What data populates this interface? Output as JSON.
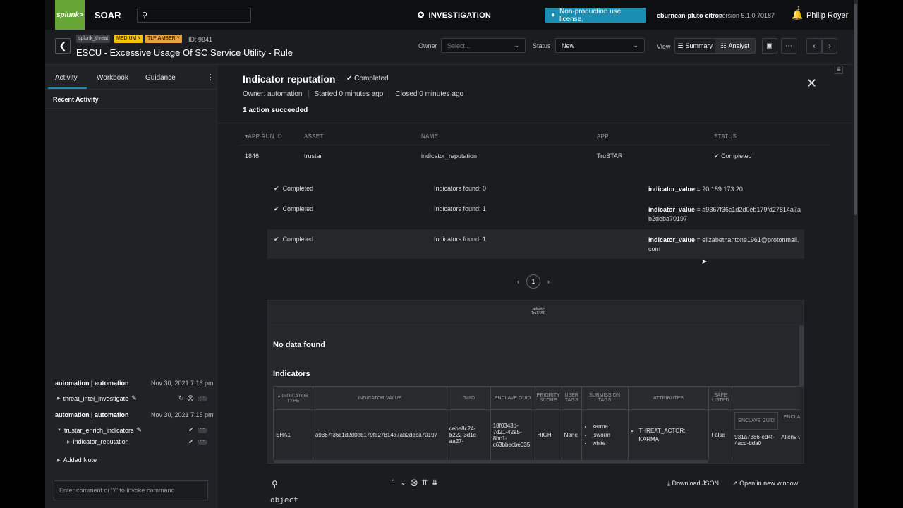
{
  "app": {
    "logo": "splunk>",
    "name": "SOAR",
    "section": "INVESTIGATION",
    "license": "Non-production use license.",
    "instance": "eburnean-pluto-citron",
    "version": "version 5.1.0.70187",
    "bell_count": "1",
    "user": "Philip Royer"
  },
  "event": {
    "tags": [
      "splunk_threat",
      "MEDIUM",
      "TLP:AMBER"
    ],
    "id_label": "ID: 9941",
    "title": "ESCU - Excessive Usage Of SC Service Utility - Rule",
    "owner_label": "Owner",
    "owner_placeholder": "Select...",
    "status_label": "Status",
    "status_value": "New",
    "view_label": "View",
    "view_summary": "Summary",
    "view_analyst": "Analyst"
  },
  "left": {
    "tabs": [
      "Activity",
      "Workbook",
      "Guidance"
    ],
    "recent_label": "Recent Activity",
    "activities": [
      {
        "user": "automation | automation",
        "date": "Nov 30, 2021 7:16 pm",
        "item": "threat_intel_investigate"
      },
      {
        "user": "automation | automation",
        "date": "Nov 30, 2021 7:16 pm",
        "item": "trustar_enrich_indicators",
        "child": "indicator_reputation"
      }
    ],
    "added_note": "Added Note",
    "comment_placeholder": "Enter comment or \"/\" to invoke command"
  },
  "result": {
    "title": "Indicator reputation",
    "status": "Completed",
    "owner": "Owner: automation",
    "started": "Started 0 minutes ago",
    "closed": "Closed 0 minutes ago",
    "summary": "1 action succeeded",
    "columns": [
      "APP RUN ID",
      "ASSET",
      "NAME",
      "APP",
      "STATUS"
    ],
    "row": {
      "run_id": "1846",
      "asset": "trustar",
      "name": "indicator_reputation",
      "app": "TruSTAR",
      "status": "Completed"
    },
    "items": [
      {
        "status": "Completed",
        "count": "Indicators found: 0",
        "key": "indicator_value",
        "value": "= 20.189.173.20"
      },
      {
        "status": "Completed",
        "count": "Indicators found: 1",
        "key": "indicator_value",
        "value": "= a9367f36c1d2d0eb179fd27814a7ab2deba70197"
      },
      {
        "status": "Completed",
        "count": "Indicators found: 1",
        "key": "indicator_value",
        "value": "= elizabethantone1961@protonmail.com"
      }
    ],
    "page": "1"
  },
  "widget": {
    "logo_line1": "splunk>",
    "logo_line2": "TruSTAR",
    "no_data": "No data found",
    "indicators_title": "Indicators",
    "headers": [
      "INDICATOR TYPE",
      "INDICATOR VALUE",
      "GUID",
      "ENCLAVE GUID",
      "PRIORITY SCORE",
      "USER TAGS",
      "SUBMISSION TAGS",
      "ATTRIBUTES",
      "SAFE LISTED",
      ""
    ],
    "row": {
      "type": "SHA1",
      "value": "a9367f36c1d2d0eb179fd27814a7ab2deba70197",
      "guid": "cebe8c24-b222-3d1e-aa27-",
      "enclave_guid": "18f0343d-7d21-42a5-8bc1-c63bbecbe035",
      "priority": "HIGH",
      "user_tags": "None",
      "submission_tags": [
        "karma",
        "jsworm",
        "white"
      ],
      "attributes": "THREAT_ACTOR: KARMA",
      "safe_listed": "False",
      "nested_h1": "ENCLAVE GUID",
      "nested_h2": "ENCLA NAM",
      "nested_v1": "931a7386-ed4f-4acd-bda0",
      "nested_v2": "Alienv OTX"
    }
  },
  "json_bar": {
    "download": "Download JSON",
    "open_window": "Open in new window",
    "object": "object"
  }
}
